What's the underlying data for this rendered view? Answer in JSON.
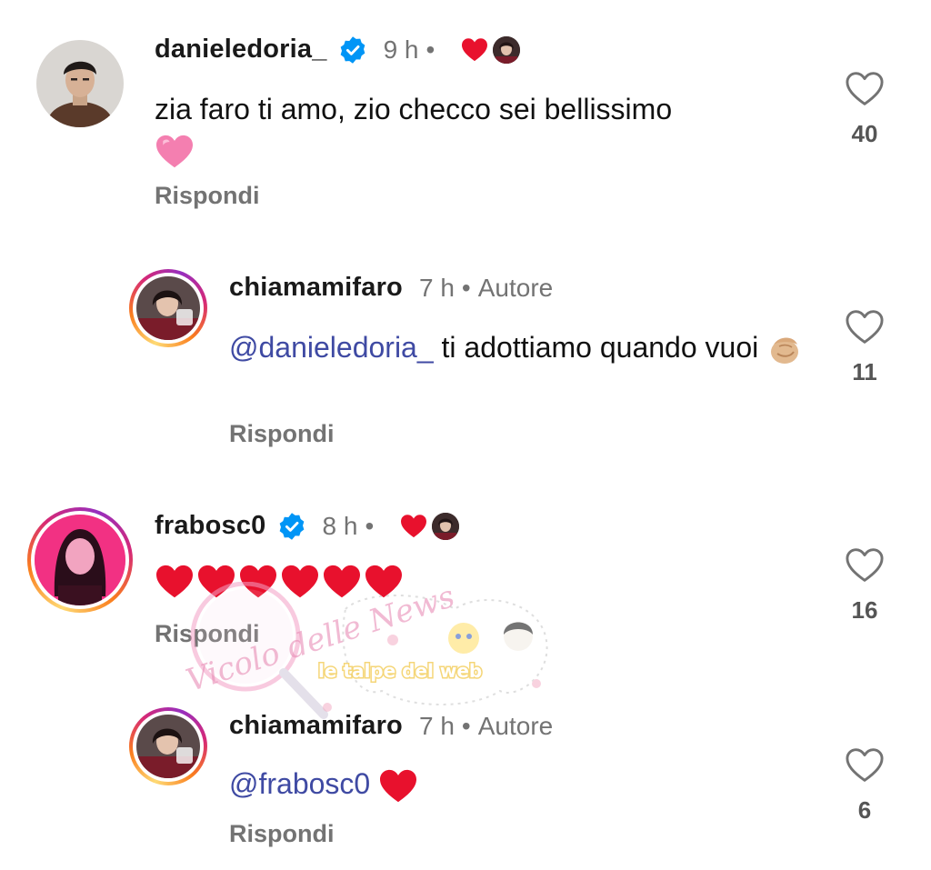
{
  "comments": [
    {
      "username": "danieledoria_",
      "verified": true,
      "time": "9 h",
      "dot": "•",
      "liked_by_author": true,
      "text": "zia faro ti amo, zio checco sei bellissimo",
      "emoji": "pink-heart",
      "reply_label": "Rispondi",
      "likes": "40"
    },
    {
      "username": "chiamamifaro",
      "verified": false,
      "time": "7 h",
      "dot": "•",
      "author_label": "Autore",
      "mention": "@danieledoria_",
      "text": " ti adottiamo quando vuoi",
      "emoji": "pinched-fingers",
      "reply_label": "Rispondi",
      "likes": "11"
    },
    {
      "username": "frabosc0",
      "verified": true,
      "time": "8 h",
      "dot": "•",
      "liked_by_author": true,
      "text": "",
      "emoji": "six-red-hearts",
      "reply_label": "Rispondi",
      "likes": "16"
    },
    {
      "username": "chiamamifaro",
      "verified": false,
      "time": "7 h",
      "dot": "•",
      "author_label": "Autore",
      "mention": "@frabosc0",
      "text": "",
      "emoji": "red-heart",
      "reply_label": "Rispondi",
      "likes": "6"
    }
  ],
  "watermark": {
    "left_text": "Vicolo delle News",
    "right_text": "le talpe del web"
  },
  "colors": {
    "mention": "#3f4aa3",
    "muted": "#737373",
    "heart": "#e8112d",
    "verified": "#0095f6"
  },
  "icons": {
    "verified": "verified-badge-icon",
    "like": "heart-outline-icon",
    "liked_by_author": "red-heart-icon"
  }
}
